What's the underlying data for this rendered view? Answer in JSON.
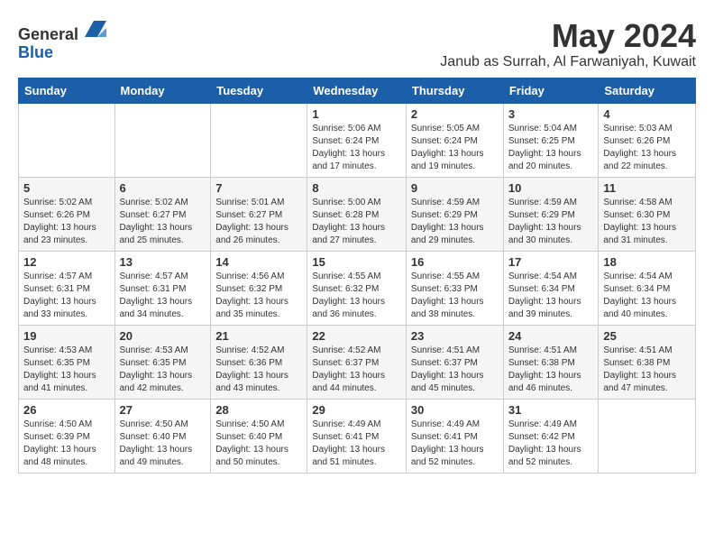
{
  "logo": {
    "general": "General",
    "blue": "Blue"
  },
  "title": "May 2024",
  "location": "Janub as Surrah, Al Farwaniyah, Kuwait",
  "weekdays": [
    "Sunday",
    "Monday",
    "Tuesday",
    "Wednesday",
    "Thursday",
    "Friday",
    "Saturday"
  ],
  "weeks": [
    [
      {
        "day": "",
        "info": ""
      },
      {
        "day": "",
        "info": ""
      },
      {
        "day": "",
        "info": ""
      },
      {
        "day": "1",
        "info": "Sunrise: 5:06 AM\nSunset: 6:24 PM\nDaylight: 13 hours\nand 17 minutes."
      },
      {
        "day": "2",
        "info": "Sunrise: 5:05 AM\nSunset: 6:24 PM\nDaylight: 13 hours\nand 19 minutes."
      },
      {
        "day": "3",
        "info": "Sunrise: 5:04 AM\nSunset: 6:25 PM\nDaylight: 13 hours\nand 20 minutes."
      },
      {
        "day": "4",
        "info": "Sunrise: 5:03 AM\nSunset: 6:26 PM\nDaylight: 13 hours\nand 22 minutes."
      }
    ],
    [
      {
        "day": "5",
        "info": "Sunrise: 5:02 AM\nSunset: 6:26 PM\nDaylight: 13 hours\nand 23 minutes."
      },
      {
        "day": "6",
        "info": "Sunrise: 5:02 AM\nSunset: 6:27 PM\nDaylight: 13 hours\nand 25 minutes."
      },
      {
        "day": "7",
        "info": "Sunrise: 5:01 AM\nSunset: 6:27 PM\nDaylight: 13 hours\nand 26 minutes."
      },
      {
        "day": "8",
        "info": "Sunrise: 5:00 AM\nSunset: 6:28 PM\nDaylight: 13 hours\nand 27 minutes."
      },
      {
        "day": "9",
        "info": "Sunrise: 4:59 AM\nSunset: 6:29 PM\nDaylight: 13 hours\nand 29 minutes."
      },
      {
        "day": "10",
        "info": "Sunrise: 4:59 AM\nSunset: 6:29 PM\nDaylight: 13 hours\nand 30 minutes."
      },
      {
        "day": "11",
        "info": "Sunrise: 4:58 AM\nSunset: 6:30 PM\nDaylight: 13 hours\nand 31 minutes."
      }
    ],
    [
      {
        "day": "12",
        "info": "Sunrise: 4:57 AM\nSunset: 6:31 PM\nDaylight: 13 hours\nand 33 minutes."
      },
      {
        "day": "13",
        "info": "Sunrise: 4:57 AM\nSunset: 6:31 PM\nDaylight: 13 hours\nand 34 minutes."
      },
      {
        "day": "14",
        "info": "Sunrise: 4:56 AM\nSunset: 6:32 PM\nDaylight: 13 hours\nand 35 minutes."
      },
      {
        "day": "15",
        "info": "Sunrise: 4:55 AM\nSunset: 6:32 PM\nDaylight: 13 hours\nand 36 minutes."
      },
      {
        "day": "16",
        "info": "Sunrise: 4:55 AM\nSunset: 6:33 PM\nDaylight: 13 hours\nand 38 minutes."
      },
      {
        "day": "17",
        "info": "Sunrise: 4:54 AM\nSunset: 6:34 PM\nDaylight: 13 hours\nand 39 minutes."
      },
      {
        "day": "18",
        "info": "Sunrise: 4:54 AM\nSunset: 6:34 PM\nDaylight: 13 hours\nand 40 minutes."
      }
    ],
    [
      {
        "day": "19",
        "info": "Sunrise: 4:53 AM\nSunset: 6:35 PM\nDaylight: 13 hours\nand 41 minutes."
      },
      {
        "day": "20",
        "info": "Sunrise: 4:53 AM\nSunset: 6:35 PM\nDaylight: 13 hours\nand 42 minutes."
      },
      {
        "day": "21",
        "info": "Sunrise: 4:52 AM\nSunset: 6:36 PM\nDaylight: 13 hours\nand 43 minutes."
      },
      {
        "day": "22",
        "info": "Sunrise: 4:52 AM\nSunset: 6:37 PM\nDaylight: 13 hours\nand 44 minutes."
      },
      {
        "day": "23",
        "info": "Sunrise: 4:51 AM\nSunset: 6:37 PM\nDaylight: 13 hours\nand 45 minutes."
      },
      {
        "day": "24",
        "info": "Sunrise: 4:51 AM\nSunset: 6:38 PM\nDaylight: 13 hours\nand 46 minutes."
      },
      {
        "day": "25",
        "info": "Sunrise: 4:51 AM\nSunset: 6:38 PM\nDaylight: 13 hours\nand 47 minutes."
      }
    ],
    [
      {
        "day": "26",
        "info": "Sunrise: 4:50 AM\nSunset: 6:39 PM\nDaylight: 13 hours\nand 48 minutes."
      },
      {
        "day": "27",
        "info": "Sunrise: 4:50 AM\nSunset: 6:40 PM\nDaylight: 13 hours\nand 49 minutes."
      },
      {
        "day": "28",
        "info": "Sunrise: 4:50 AM\nSunset: 6:40 PM\nDaylight: 13 hours\nand 50 minutes."
      },
      {
        "day": "29",
        "info": "Sunrise: 4:49 AM\nSunset: 6:41 PM\nDaylight: 13 hours\nand 51 minutes."
      },
      {
        "day": "30",
        "info": "Sunrise: 4:49 AM\nSunset: 6:41 PM\nDaylight: 13 hours\nand 52 minutes."
      },
      {
        "day": "31",
        "info": "Sunrise: 4:49 AM\nSunset: 6:42 PM\nDaylight: 13 hours\nand 52 minutes."
      },
      {
        "day": "",
        "info": ""
      }
    ]
  ]
}
